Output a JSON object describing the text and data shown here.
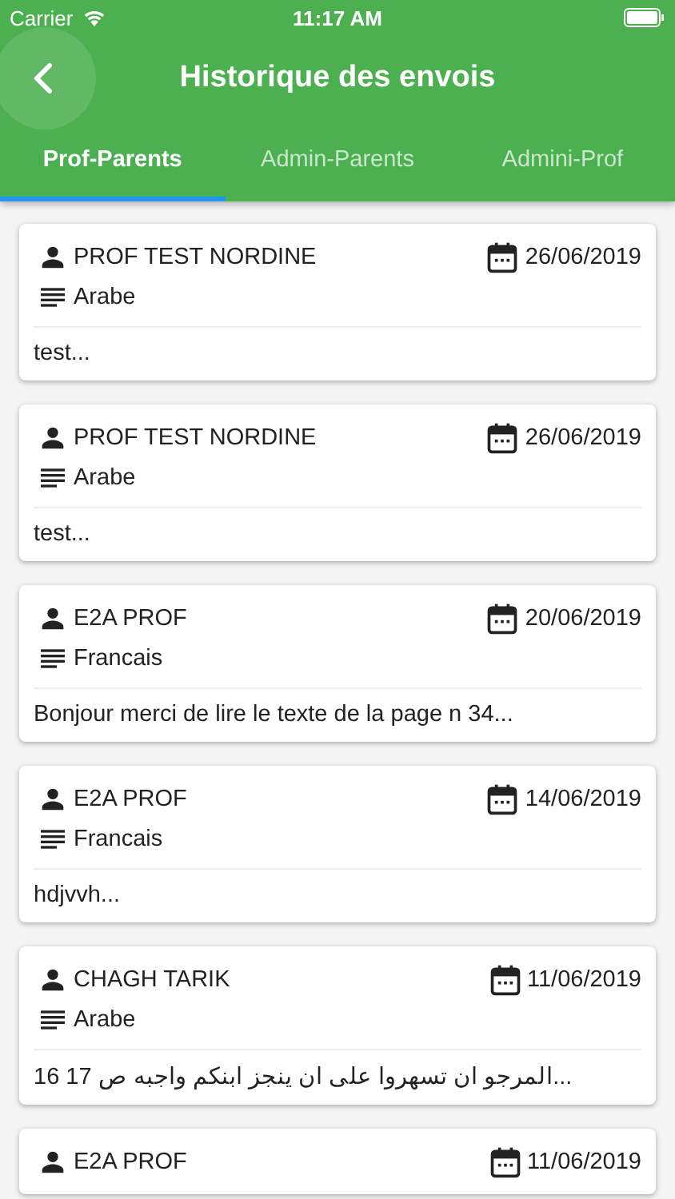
{
  "status_bar": {
    "carrier": "Carrier",
    "time": "11:17 AM"
  },
  "header": {
    "title": "Historique des envois"
  },
  "tabs": [
    {
      "label": "Prof-Parents",
      "selected": true
    },
    {
      "label": "Admin-Parents",
      "selected": false
    },
    {
      "label": "Admini-Prof",
      "selected": false
    }
  ],
  "messages": [
    {
      "sender": "PROF TEST NORDINE",
      "date": "26/06/2019",
      "subject": "Arabe",
      "preview": "test..."
    },
    {
      "sender": "PROF TEST NORDINE",
      "date": "26/06/2019",
      "subject": "Arabe",
      "preview": "test..."
    },
    {
      "sender": "E2A PROF",
      "date": "20/06/2019",
      "subject": "Francais",
      "preview": "Bonjour merci de lire le texte de la page n 34..."
    },
    {
      "sender": "E2A PROF",
      "date": "14/06/2019",
      "subject": "Francais",
      "preview": "hdjvvh..."
    },
    {
      "sender": "CHAGH TARIK",
      "date": "11/06/2019",
      "subject": "Arabe",
      "preview": "المرجو ان تسهروا على ان ينجز ابنكم واجبه ص 17 16..."
    },
    {
      "sender": "E2A PROF",
      "date": "11/06/2019"
    }
  ]
}
